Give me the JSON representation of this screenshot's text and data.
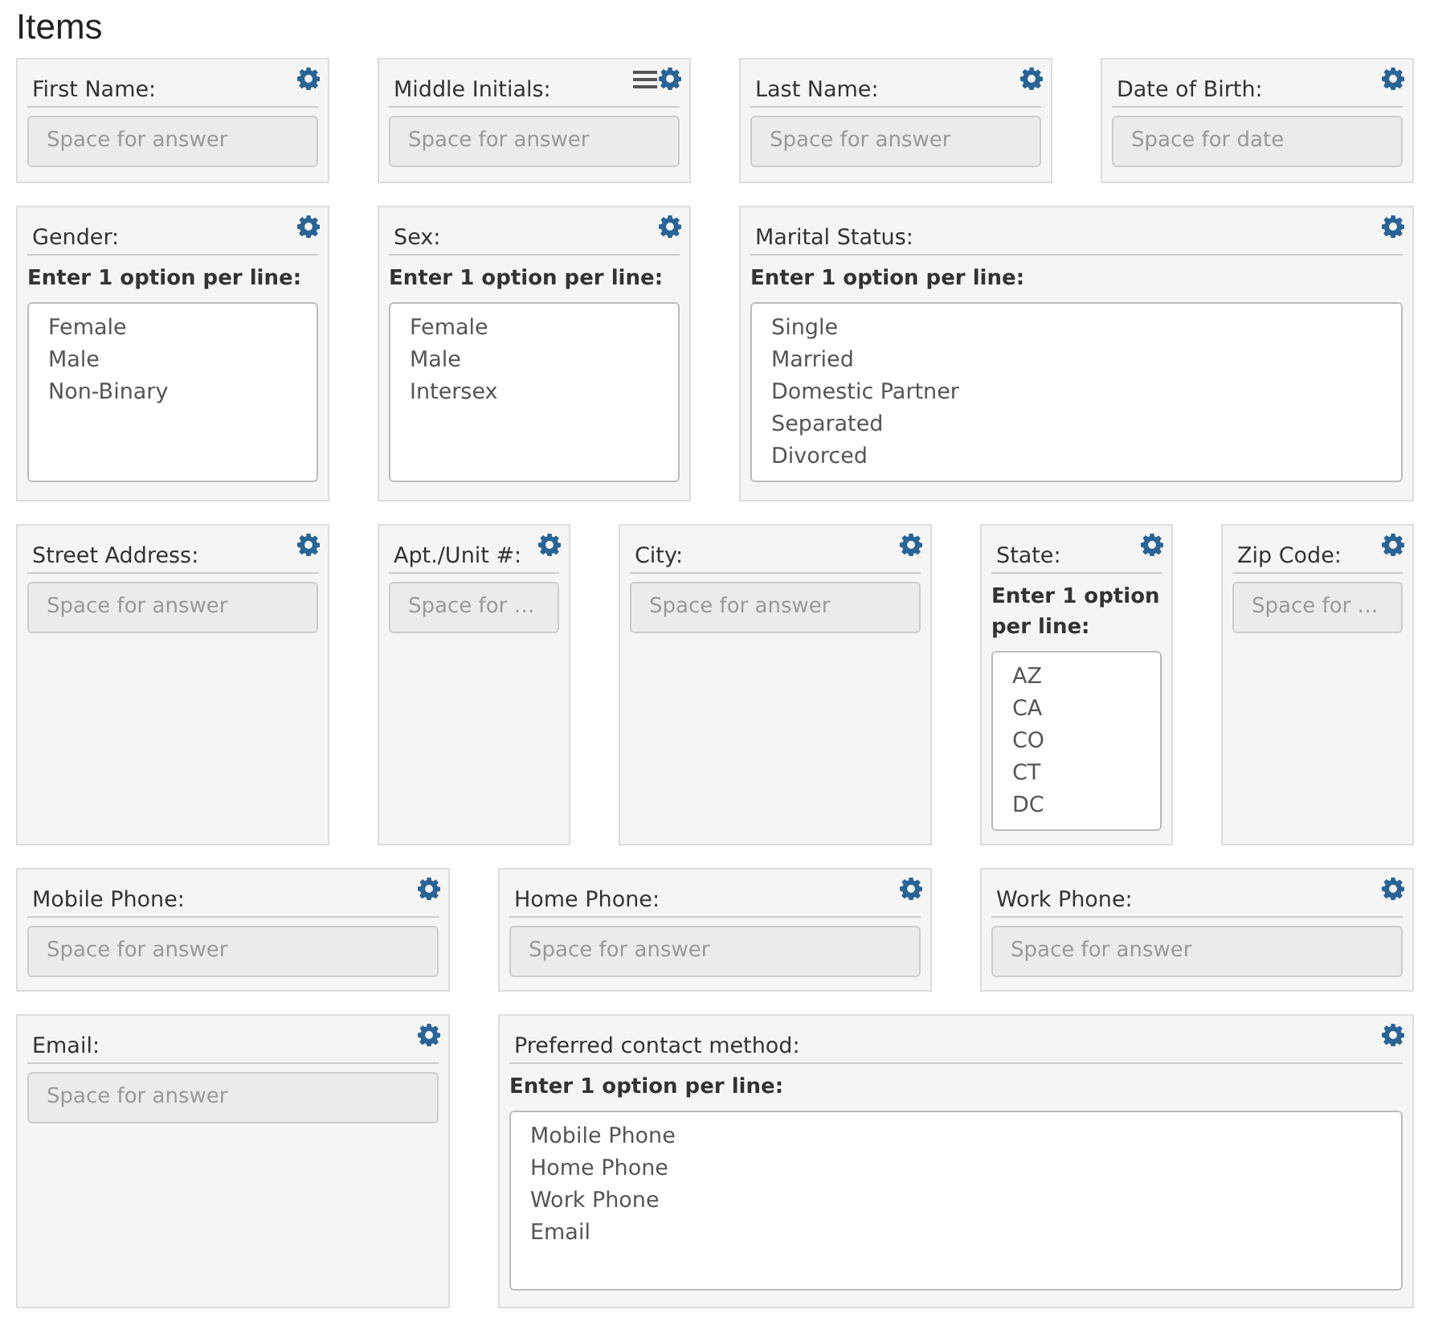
{
  "title": "Items",
  "rows": [
    {
      "items": [
        {
          "label": "First Name:",
          "kind": "input",
          "placeholder": "Space for answer",
          "menu_icon": false
        },
        {
          "label": "Middle Initials:",
          "kind": "input",
          "placeholder": "Space for answer",
          "menu_icon": true
        },
        {
          "label": "Last Name:",
          "kind": "input",
          "placeholder": "Space for answer",
          "menu_icon": false
        },
        {
          "label": "Date of Birth:",
          "kind": "input",
          "placeholder": "Space for date",
          "menu_icon": false
        }
      ]
    },
    {
      "items": [
        {
          "label": "Gender:",
          "kind": "options",
          "instruction": "Enter 1 option per line:",
          "options": [
            "Female",
            "Male",
            "Non-Binary"
          ],
          "menu_icon": false
        },
        {
          "label": "Sex:",
          "kind": "options",
          "instruction": "Enter 1 option per line:",
          "options": [
            "Female",
            "Male",
            "Intersex"
          ],
          "menu_icon": false
        },
        {
          "label": "Marital Status:",
          "kind": "options",
          "instruction": "Enter 1 option per line:",
          "options": [
            "Single",
            "Married",
            "Domestic Partner",
            "Separated",
            "Divorced"
          ],
          "menu_icon": false
        }
      ]
    },
    {
      "items": [
        {
          "label": "Street Address:",
          "kind": "input",
          "placeholder": "Space for answer",
          "menu_icon": false
        },
        {
          "label": "Apt./Unit #:",
          "kind": "input",
          "placeholder": "Space for …",
          "menu_icon": false
        },
        {
          "label": "City:",
          "kind": "input",
          "placeholder": "Space for answer",
          "menu_icon": false
        },
        {
          "label": "State:",
          "kind": "options",
          "instruction": "Enter 1 option per line:",
          "options": [
            "AZ",
            "CA",
            "CO",
            "CT",
            "DC"
          ],
          "menu_icon": false
        },
        {
          "label": "Zip Code:",
          "kind": "input",
          "placeholder": "Space for …",
          "menu_icon": false
        }
      ]
    },
    {
      "items": [
        {
          "label": "Mobile Phone:",
          "kind": "input",
          "placeholder": "Space for answer",
          "menu_icon": false
        },
        {
          "label": "Home Phone:",
          "kind": "input",
          "placeholder": "Space for answer",
          "menu_icon": false
        },
        {
          "label": "Work Phone:",
          "kind": "input",
          "placeholder": "Space for answer",
          "menu_icon": false
        }
      ]
    },
    {
      "items": [
        {
          "label": "Email:",
          "kind": "input",
          "placeholder": "Space for answer",
          "menu_icon": false
        },
        {
          "label": "Preferred contact method:",
          "kind": "options",
          "instruction": "Enter 1 option per line:",
          "options": [
            "Mobile Phone",
            "Home Phone",
            "Work Phone",
            "Email"
          ],
          "menu_icon": false
        }
      ]
    }
  ]
}
